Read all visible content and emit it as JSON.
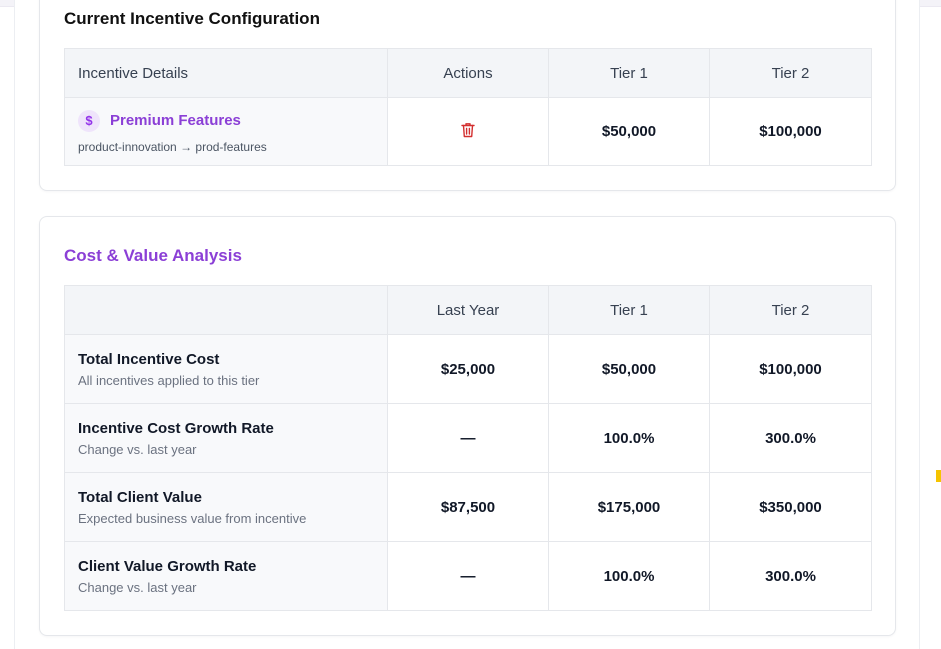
{
  "config_card": {
    "title": "Current Incentive Configuration",
    "headers": [
      "Incentive Details",
      "Actions",
      "Tier 1",
      "Tier 2"
    ],
    "incentive": {
      "icon": "dollar-icon",
      "name": "Premium Features",
      "path": "product-innovation → prod-features",
      "action_icon": "trash-icon",
      "tier1": "$50,000",
      "tier2": "$100,000"
    }
  },
  "analysis_card": {
    "title": "Cost & Value Analysis",
    "headers": [
      "",
      "Last Year",
      "Tier 1",
      "Tier 2"
    ],
    "rows": [
      {
        "title": "Total Incentive Cost",
        "subtitle": "All incentives applied to this tier",
        "last_year": "$25,000",
        "tier1": "$50,000",
        "tier2": "$100,000"
      },
      {
        "title": "Incentive Cost Growth Rate",
        "subtitle": "Change vs. last year",
        "last_year": "—",
        "tier1": "100.0%",
        "tier2": "300.0%"
      },
      {
        "title": "Total Client Value",
        "subtitle": "Expected business value from incentive",
        "last_year": "$87,500",
        "tier1": "$175,000",
        "tier2": "$350,000"
      },
      {
        "title": "Client Value Growth Rate",
        "subtitle": "Change vs. last year",
        "last_year": "—",
        "tier1": "100.0%",
        "tier2": "300.0%"
      }
    ]
  },
  "colors": {
    "accent_purple": "#8b3fd6",
    "negative_red": "#d32f2f",
    "positive_green": "#1f9d4c",
    "header_bg": "#f3f5f8"
  }
}
